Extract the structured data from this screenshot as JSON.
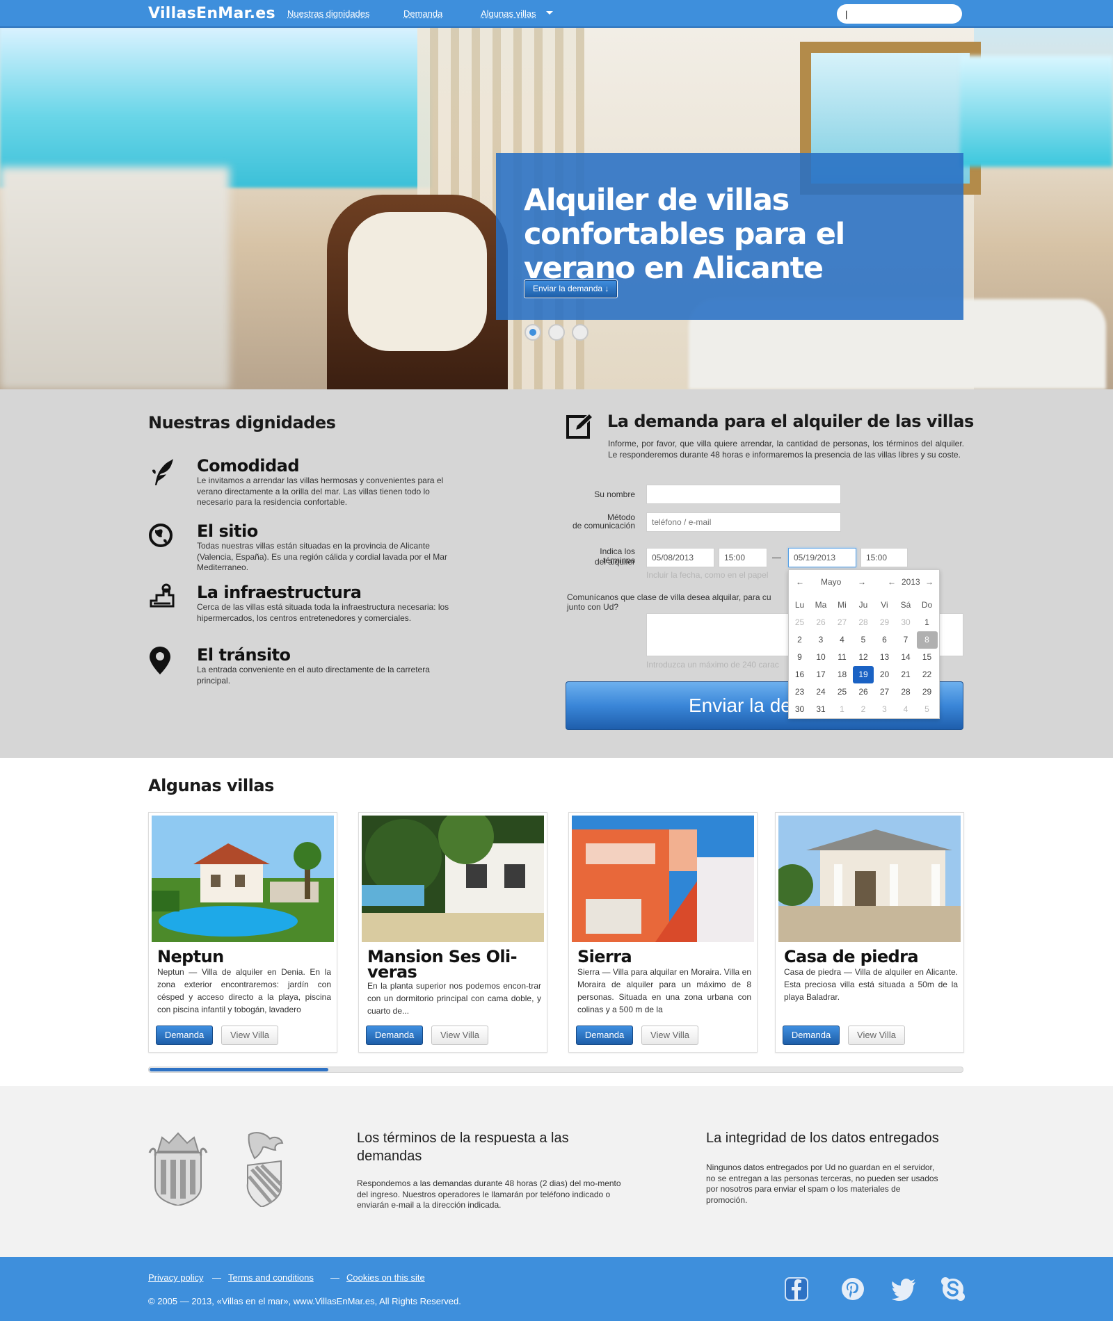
{
  "nav": {
    "logo": "VillasEnMar.es",
    "links": [
      "Nuestras dignidades",
      "Demanda",
      "Algunas villas"
    ],
    "search_value": "|"
  },
  "hero": {
    "title": "Alquiler de villas confortables para el verano en Alicante",
    "button": "Enviar la demanda ↓",
    "slides_count": 3,
    "active_slide": 1
  },
  "features": {
    "title": "Nuestras dignidades",
    "items": [
      {
        "title": "Comodidad",
        "text": "Le invitamos a arrendar las villas hermosas y convenientes para el verano directamente a la orilla del mar. Las villas tienen todo lo necesario para la residencia confortable.",
        "icon": "leaf-icon"
      },
      {
        "title": "El sitio",
        "text": "Todas nuestras villas están situadas en la provincia de Alicante (Valencia, España). Es una región cálida y cordial  lavada por el Mar Mediterraneo.",
        "icon": "globe-icon"
      },
      {
        "title": "La infraestructura",
        "text": "Cerca de las villas está situada toda la infraestructura necesaria: los hipermercados, los centros entretenedores y comerciales.",
        "icon": "infrastructure-icon"
      },
      {
        "title": "El tránsito",
        "text": "La entrada conveniente en el auto directamente de la carretera principal.",
        "icon": "location-pin-icon"
      }
    ]
  },
  "form": {
    "title": "La demanda para el alquiler de las villas",
    "intro": "Informe, por favor, que villa quiere arrendar, la cantidad de personas, los términos del alquiler. Le responderemos durante 48 horas e informaremos la presencia de las villas libres y su coste.",
    "name_label": "Su nombre",
    "name_value": "",
    "method_label_1": "Método",
    "method_label_2": "de comunicación",
    "method_placeholder": "teléfono / e-mail",
    "terms_label_1": "Indica los términos",
    "terms_label_2": "del alquiler",
    "date_from": "05/08/2013",
    "time_from": "15:00",
    "dash": "—",
    "date_to": "05/19/2013",
    "time_to": "15:00",
    "date_hint": "Incluir la fecha, como en el papel",
    "message_label_1": "Comunícanos  que clase de villa desea alquilar, para cu",
    "message_label_2": "junto con Ud?",
    "message_hint": "Introduzca un máximo de 240 carac",
    "submit": "Enviar la demanda"
  },
  "calendar": {
    "prev": "←",
    "month": "Mayo",
    "next": "→",
    "year_prev": "←",
    "year": "2013",
    "year_next": "→",
    "weekdays": [
      "Lu",
      "Ma",
      "Mi",
      "Ju",
      "Vi",
      "Sá",
      "Do"
    ],
    "weeks": [
      [
        "25",
        "26",
        "27",
        "28",
        "29",
        "30",
        "1"
      ],
      [
        "2",
        "3",
        "4",
        "5",
        "6",
        "7",
        "8"
      ],
      [
        "9",
        "10",
        "11",
        "12",
        "13",
        "14",
        "15"
      ],
      [
        "16",
        "17",
        "18",
        "19",
        "20",
        "21",
        "22"
      ],
      [
        "23",
        "24",
        "25",
        "26",
        "27",
        "28",
        "29"
      ],
      [
        "30",
        "31",
        "1",
        "2",
        "3",
        "4",
        "5"
      ]
    ],
    "selected_day": "19",
    "today_day": "8"
  },
  "villas": {
    "title": "Algunas villas",
    "demand_label": "Demanda",
    "view_label": "View Villa",
    "items": [
      {
        "name": "Neptun",
        "text": "Neptun — Villa de alquiler en Denia. En la zona exterior encontraremos: jardín con césped y acceso directo a la playa, piscina con piscina infantil y tobogán, lavadero"
      },
      {
        "name": "Mansion Ses Oli-veras",
        "text": "En la planta superior nos podemos encon-trar con un dormitorio principal con cama doble, y cuarto de..."
      },
      {
        "name": "Sierra",
        "text": "Sierra — Villa para alquilar en Moraira. Villa en Moraira de alquiler para un máximo de 8 personas. Situada en una zona urbana con colinas y a 500 m de la"
      },
      {
        "name": "Casa de piedra",
        "text": "Casa de piedra — Villa de alquiler en Alicante. Esta preciosa villa está situada a 50m de la playa Baladrar."
      }
    ],
    "scroll_fraction": 0.22
  },
  "info": {
    "col1_title": "Los términos de la respuesta a las demandas",
    "col1_text": "Respondemos a las demandas durante 48 horas (2 dias) del mo-mento del ingreso. Nuestros operadores le llamarán por teléfono indicado o enviarán e-mail a la dirección indicada.",
    "col2_title": "La integridad de los datos entregados",
    "col2_text": "Ningunos datos entregados por Ud no guardan en el servidor, no se entregan a las personas terceras, no pueden ser usados por nosotros para  enviar el spam o los materiales de promoción."
  },
  "footer": {
    "links": [
      "Privacy policy",
      "Terms and conditions",
      "Cookies on this site"
    ],
    "sep": "—",
    "copyright": "© 2005 — 2013,  «Villas en el mar», www.VillasEnMar.es, All Rights Reserved.",
    "social": [
      "facebook-icon",
      "pinterest-icon",
      "twitter-icon",
      "skype-icon"
    ]
  }
}
